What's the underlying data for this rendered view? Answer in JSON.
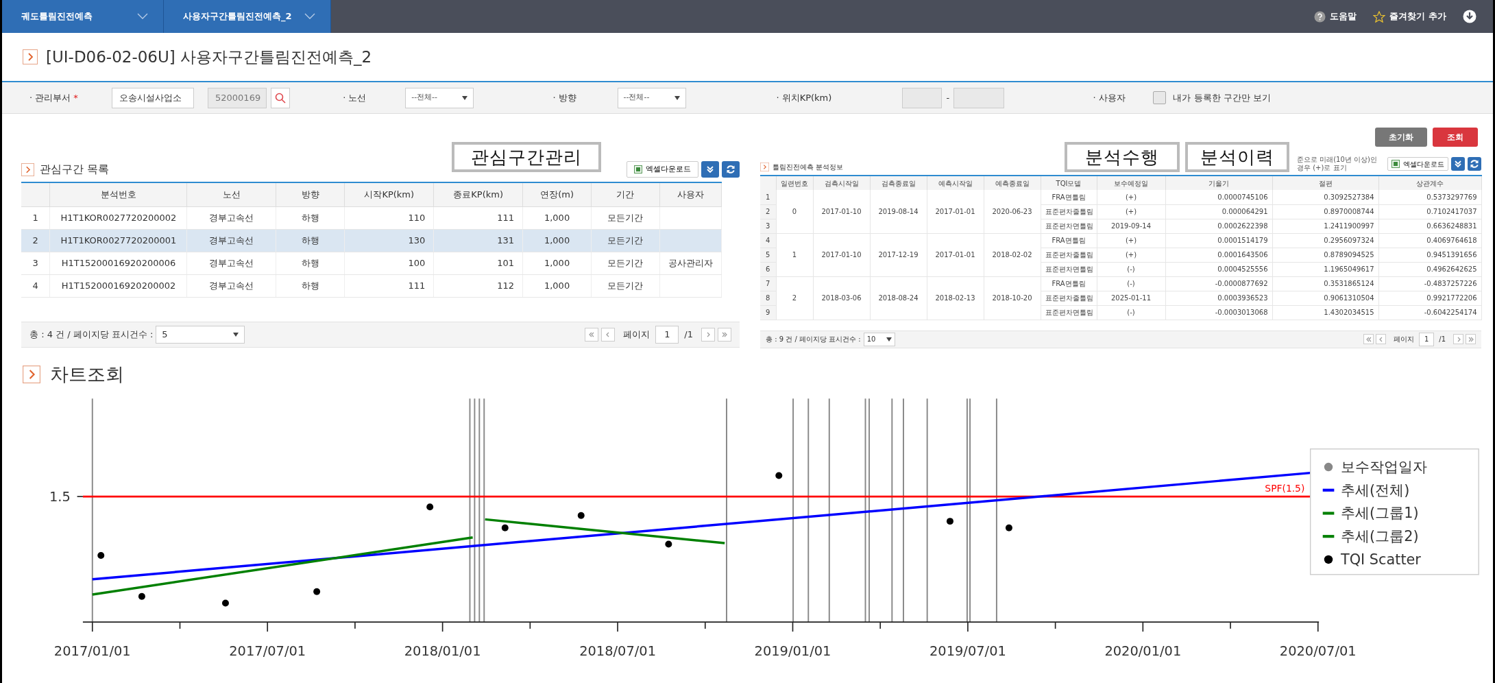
{
  "top_bar": {
    "tabs": [
      {
        "label": "궤도틀림진전예측"
      },
      {
        "label": "사용자구간틀림진전예측_2"
      }
    ],
    "links": [
      {
        "kind": "help",
        "label": "도움말"
      },
      {
        "kind": "favorite",
        "label": "즐겨찾기 추가"
      }
    ]
  },
  "page_title": "[UI-D06-02-06U] 사용자구간틀림진전예측_2",
  "filters": {
    "department": {
      "label": "· 관리부서",
      "required_mark": "*",
      "value": "오송시설사업소",
      "code": "52000169"
    },
    "line": {
      "label": "· 노선",
      "value": "--전체--"
    },
    "direction": {
      "label": "· 방향",
      "value": "--전체--"
    },
    "position": {
      "label": "· 위치KP(km)",
      "separator": "-"
    },
    "user": {
      "label": "· 사용자",
      "checkbox_label": "내가 등록한 구간만 보기",
      "checked": false
    }
  },
  "buttons": [
    {
      "kind": "reset",
      "label": "초기화"
    },
    {
      "kind": "search",
      "label": "조회"
    }
  ],
  "left_panel": {
    "title": "관심구간 목록",
    "annotation": "관심구간관리",
    "excel_button": "엑셀다운로드",
    "columns": [
      "분석번호",
      "노선",
      "방향",
      "시작KP(km)",
      "종료KP(km)",
      "연장(m)",
      "기간",
      "사용자"
    ],
    "rows": [
      {
        "no": "1",
        "id": "H1T1KOR0027720200002",
        "line": "경부고속선",
        "direction": "하행",
        "start_kp": "110",
        "end_kp": "111",
        "length": "1,000",
        "period": "모든기간",
        "selected": false
      },
      {
        "no": "2",
        "id": "H1T1KOR0027720200001",
        "line": "경부고속선",
        "direction": "하행",
        "start_kp": "130",
        "end_kp": "131",
        "length": "1,000",
        "period": "모든기간",
        "selected": true
      },
      {
        "no": "3",
        "id": "H1T15200016920200006",
        "line": "경부고속선",
        "direction": "하행",
        "start_kp": "100",
        "end_kp": "101",
        "length": "1,000",
        "period": "모든기간",
        "user": "공사관리자",
        "selected": false
      },
      {
        "no": "4",
        "id": "H1T15200016920200002",
        "line": "경부고속선",
        "direction": "하행",
        "start_kp": "111",
        "end_kp": "112",
        "length": "1,000",
        "period": "모든기간",
        "selected": false
      }
    ],
    "footer": {
      "summary": "총 : 4 건 / 페이지당 표시건수 :",
      "page_size": "5",
      "page_label": "페이지",
      "page": "1",
      "page_total": "/1"
    }
  },
  "right_panel": {
    "title": "틀림진전예측 분석정보",
    "annotations": [
      "분석수행",
      "분석이력"
    ],
    "note": "준으로 미래(10년 이상)인 경우 (+)로 표기",
    "excel_button": "엑셀다운로드",
    "columns": [
      "일련번호",
      "검측시작일",
      "검측종료일",
      "예측시작일",
      "예측종료일",
      "TQI모델",
      "보수예정일",
      "기울기",
      "절편",
      "상관계수"
    ],
    "groups": [
      {
        "serial": "0",
        "inspect_start": "2017-01-10",
        "inspect_end": "2019-08-14",
        "predict_start": "2017-01-01",
        "predict_end": "2020-06-23",
        "rows": [
          {
            "no": "1",
            "model": "FRA면틀림",
            "maintenance_date": "(+)",
            "slope": "0.0000745106",
            "intercept": "0.3092527384",
            "correlation": "0.5373297769"
          },
          {
            "no": "2",
            "model": "표준편차줄틀림",
            "maintenance_date": "(+)",
            "slope": "0.000064291",
            "intercept": "0.8970008744",
            "correlation": "0.7102417037"
          },
          {
            "no": "3",
            "model": "표준편차면틀림",
            "maintenance_date": "2019-09-14",
            "slope": "0.0002622398",
            "intercept": "1.2411900997",
            "correlation": "0.6636248831"
          }
        ]
      },
      {
        "serial": "1",
        "inspect_start": "2017-01-10",
        "inspect_end": "2017-12-19",
        "predict_start": "2017-01-01",
        "predict_end": "2018-02-02",
        "rows": [
          {
            "no": "4",
            "model": "FRA면틀림",
            "maintenance_date": "(+)",
            "slope": "0.0001514179",
            "intercept": "0.2956097324",
            "correlation": "0.4069764618"
          },
          {
            "no": "5",
            "model": "표준편차줄틀림",
            "maintenance_date": "(+)",
            "slope": "0.0001643506",
            "intercept": "0.8789094525",
            "correlation": "0.9451391656"
          },
          {
            "no": "6",
            "model": "표준편차면틀림",
            "maintenance_date": "(-)",
            "slope": "0.0004525556",
            "intercept": "1.1965049617",
            "correlation": "0.4962642625"
          }
        ]
      },
      {
        "serial": "2",
        "inspect_start": "2018-03-06",
        "inspect_end": "2018-08-24",
        "predict_start": "2018-02-13",
        "predict_end": "2018-10-20",
        "rows": [
          {
            "no": "7",
            "model": "FRA면틀림",
            "maintenance_date": "(-)",
            "slope": "-0.0000877692",
            "intercept": "0.3531865124",
            "correlation": "-0.4837257226"
          },
          {
            "no": "8",
            "model": "표준편차줄틀림",
            "maintenance_date": "2025-01-11",
            "slope": "0.0003936523",
            "intercept": "0.9061310504",
            "correlation": "0.9921772206"
          },
          {
            "no": "9",
            "model": "표준편차면틀림",
            "maintenance_date": "(-)",
            "slope": "-0.0003013068",
            "intercept": "1.4302034515",
            "correlation": "-0.6042254174"
          }
        ]
      }
    ],
    "footer": {
      "summary": "총 : 9 건 / 페이지당 표시건수 :",
      "page_size": "10",
      "page_label": "페이지",
      "page": "1",
      "page_total": "/1"
    }
  },
  "chart": {
    "title": "차트조회",
    "y_tick": "1.5",
    "threshold_label": "SPF(1.5)",
    "x_ticks": [
      "2017/01/01",
      "2017/07/01",
      "2018/01/01",
      "2018/07/01",
      "2019/01/01",
      "2019/07/01",
      "2020/01/01",
      "2020/07/01"
    ],
    "legend": [
      {
        "kind": "dot",
        "label": "보수작업일자",
        "color": "#888888"
      },
      {
        "kind": "line",
        "label": "추세(전체)",
        "color": "#0000ff"
      },
      {
        "kind": "line",
        "label": "추세(그룹1)",
        "color": "#008000"
      },
      {
        "kind": "line",
        "label": "추세(그룹2)",
        "color": "#008000"
      },
      {
        "kind": "dot",
        "label": "TQI Scatter",
        "color": "#000000"
      }
    ]
  }
}
